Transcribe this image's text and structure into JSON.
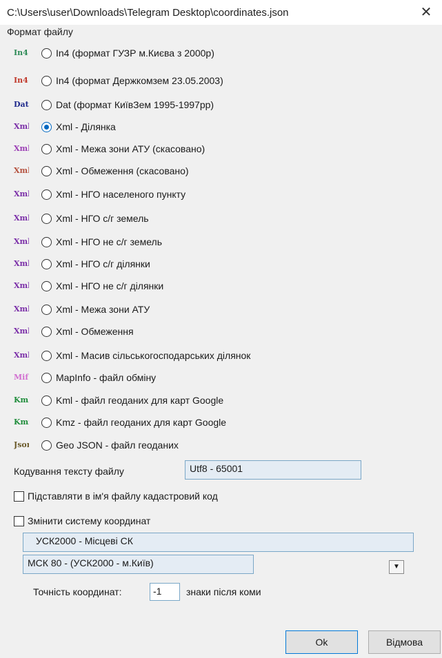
{
  "window": {
    "title": "C:\\Users\\user\\Downloads\\Telegram Desktop\\coordinates.json",
    "close_glyph": "✕"
  },
  "format_group": {
    "label": "Формат файлу",
    "options": [
      {
        "icon_text": "In4",
        "icon": "in4-gyzr-icon",
        "label": "In4 (формат ГУЗР м.Києва з 2000р)",
        "checked": false,
        "color": "#2e8b57"
      },
      {
        "icon_text": "In4",
        "icon": "in4-derzhkomzem-icon",
        "label": "In4 (формат Держкомзем 23.05.2003)",
        "checked": false,
        "color": "#c0392b"
      },
      {
        "icon_text": "Dat",
        "icon": "dat-icon",
        "label": "Dat (формат КиївЗем 1995-1997рр)",
        "checked": false,
        "color": "#1f2a8c"
      },
      {
        "icon_text": "Xml",
        "icon": "xml-icon",
        "label": "Xml - Ділянка",
        "checked": true,
        "color": "#7b2fa8"
      },
      {
        "icon_text": "Xml",
        "icon": "xml-cancelled-icon",
        "label": "Xml - Межа зони АТУ (скасовано)",
        "checked": false,
        "color": "#9b3fb5"
      },
      {
        "icon_text": "Xml",
        "icon": "xml-cancelled-icon",
        "label": "Xml - Обмеження (скасовано)",
        "checked": false,
        "color": "#b5523f"
      },
      {
        "icon_text": "Xml",
        "icon": "xml-icon",
        "label": "Xml - НГО населеного пункту",
        "checked": false,
        "color": "#7b2fa8"
      },
      {
        "icon_text": "Xml",
        "icon": "xml-icon",
        "label": "Xml - НГО с/г земель",
        "checked": false,
        "color": "#7b2fa8"
      },
      {
        "icon_text": "Xml",
        "icon": "xml-icon",
        "label": "Xml - НГО не с/г земель",
        "checked": false,
        "color": "#7b2fa8"
      },
      {
        "icon_text": "Xml",
        "icon": "xml-icon",
        "label": "Xml - НГО с/г ділянки",
        "checked": false,
        "color": "#7b2fa8"
      },
      {
        "icon_text": "Xml",
        "icon": "xml-icon",
        "label": "Xml - НГО не с/г ділянки",
        "checked": false,
        "color": "#7b2fa8"
      },
      {
        "icon_text": "Xml",
        "icon": "xml-icon",
        "label": "Xml - Межа зони АТУ",
        "checked": false,
        "color": "#7b2fa8"
      },
      {
        "icon_text": "Xml",
        "icon": "xml-icon",
        "label": "Xml - Обмеження",
        "checked": false,
        "color": "#7b2fa8"
      },
      {
        "icon_text": "Xml",
        "icon": "xml-icon",
        "label": "Xml - Масив сільськогосподарських ділянок",
        "checked": false,
        "color": "#7b2fa8"
      },
      {
        "icon_text": "Mif",
        "icon": "mapinfo-icon",
        "label": "MapInfo - файл обміну",
        "checked": false,
        "color": "#d26fd0"
      },
      {
        "icon_text": "Kml",
        "icon": "kml-icon",
        "label": "Kml - файл геоданих для карт Google",
        "checked": false,
        "color": "#1e8c3a"
      },
      {
        "icon_text": "Kmz",
        "icon": "kmz-icon",
        "label": "Kmz - файл геоданих для карт Google",
        "checked": false,
        "color": "#1e8c3a"
      },
      {
        "icon_text": "Json",
        "icon": "json-icon",
        "label": "Geo JSON - файл геоданих",
        "checked": false,
        "color": "#6b5a2a"
      }
    ]
  },
  "encoding": {
    "label": "Кодування тексту файлу",
    "value": "Utf8 - 65001"
  },
  "cadastral_checkbox": {
    "label": "Підставляти в ім'я файлу кадастровий код",
    "checked": false
  },
  "coord_checkbox": {
    "label": "Змінити систему координат",
    "checked": false
  },
  "source_cs": "УСК2000 - Місцеві СК",
  "target_cs": "МСК 80 - (УСК2000 - м.Київ)",
  "dropdown_glyph": "▼",
  "precision": {
    "label": "Точність координат:",
    "value": "-1",
    "suffix": "знаки після коми"
  },
  "buttons": {
    "ok": "Ok",
    "cancel": "Відмова"
  },
  "colors": {
    "accent": "#0067c0",
    "textbox_bg": "#e4ecf4",
    "textbox_border": "#7aa7c7"
  }
}
